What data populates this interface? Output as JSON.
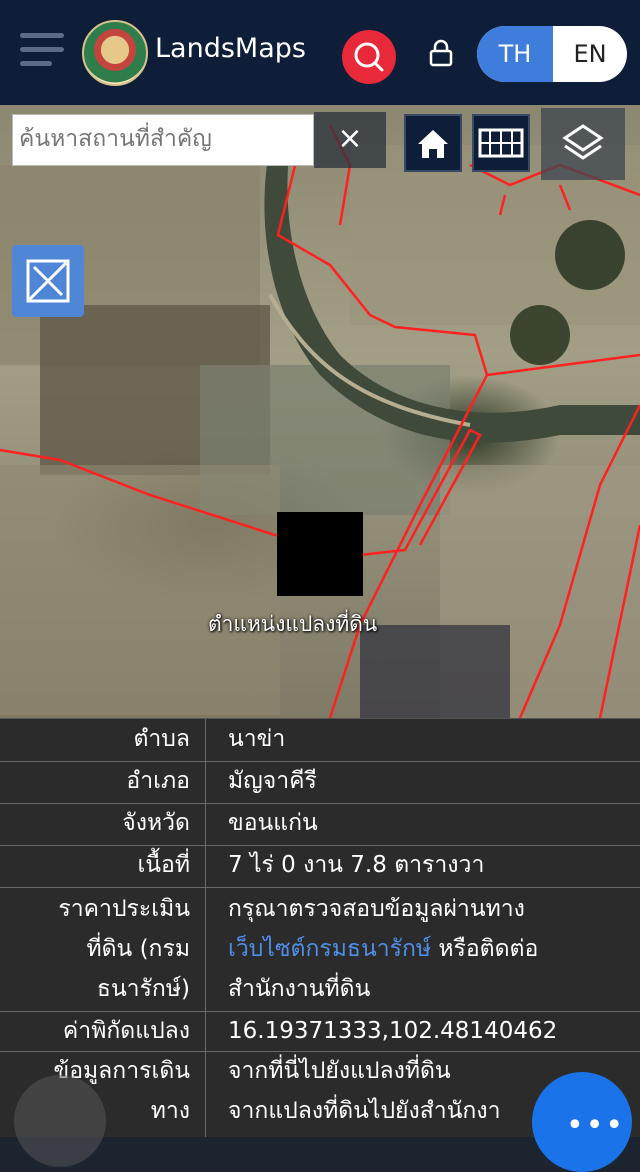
{
  "header": {
    "app_name": "LandsMaps",
    "lang_th": "TH",
    "lang_en": "EN",
    "accent_color": "#3e7ddc",
    "search_button_color": "#e8293a",
    "icons": [
      "hamburger-icon",
      "search-icon",
      "lock-icon"
    ]
  },
  "map": {
    "search_placeholder": "ค้นหาสถานที่สำคัญ",
    "clear_label": "×",
    "parcel_label": "ตำแหน่งแปลงที่ดิน",
    "icons": [
      "home-icon",
      "grid-icon",
      "layers-icon",
      "measure-icon"
    ],
    "boundary_color": "#ff2020"
  },
  "info": {
    "rows": [
      {
        "key": "ตำบล",
        "value": "นาข่า"
      },
      {
        "key": "อำเภอ",
        "value": "มัญจาคีรี"
      },
      {
        "key": "จังหวัด",
        "value": "ขอนแก่น"
      },
      {
        "key": "เนื้อที่",
        "value": "7 ไร่ 0 งาน 7.8 ตารางวา"
      }
    ],
    "price_key_1": "ราคาประเมิน",
    "price_key_2": "ที่ดิน (กรม",
    "price_key_3": "ธนารักษ์)",
    "price_line_1": "กรุณาตรวจสอบข้อมูลผ่านทาง",
    "price_link": "เว็บไซต์กรมธนารักษ์",
    "price_line_2_tail": " หรือติดต่อ",
    "price_line_3": "สำนักงานที่ดิน",
    "coord_key": "ค่าพิกัดแปลง",
    "coord_value": "16.19371333,102.48140462",
    "travel_key_1": "ข้อมูลการเดิน",
    "travel_key_2": "ทาง",
    "travel_link_1": "จากที่นี่ไปยังแปลงที่ดิน",
    "travel_link_2": "จากแปลงที่ดินไปยังสำนักงา",
    "fab_label": "•••"
  }
}
